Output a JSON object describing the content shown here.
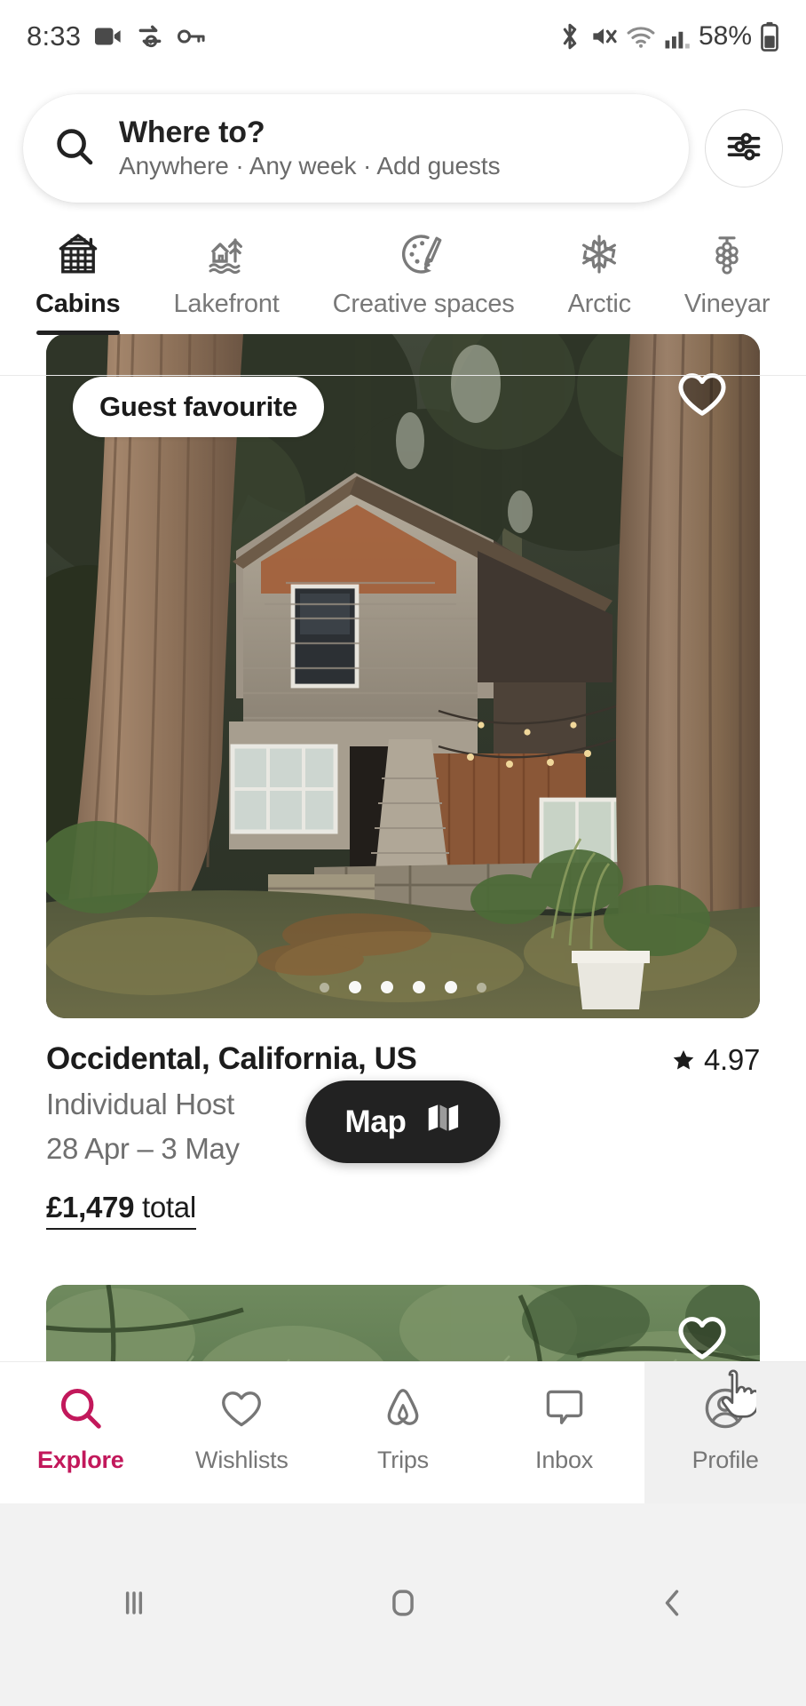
{
  "status_bar": {
    "time": "8:33",
    "left_icons": [
      "video-camera-icon",
      "sync-icon",
      "key-icon"
    ],
    "right_icons": [
      "bluetooth-icon",
      "mute-icon",
      "wifi-icon",
      "signal-icon"
    ],
    "battery_percent": "58%"
  },
  "search": {
    "title": "Where to?",
    "subtitle": "Anywhere · Any week · Add guests",
    "icon": "search-icon",
    "filter_icon": "filter-sliders-icon"
  },
  "categories": [
    {
      "label": "Cabins",
      "icon": "cabin-icon",
      "active": true
    },
    {
      "label": "Lakefront",
      "icon": "lakefront-icon",
      "active": false
    },
    {
      "label": "Creative spaces",
      "icon": "palette-icon",
      "active": false
    },
    {
      "label": "Arctic",
      "icon": "snowflake-icon",
      "active": false
    },
    {
      "label": "Vineyar",
      "icon": "grapes-icon",
      "active": false
    }
  ],
  "listing": {
    "badge": "Guest favourite",
    "location": "Occidental, California, US",
    "rating": "4.97",
    "rating_icon": "star-icon",
    "host": "Individual Host",
    "dates": "28 Apr – 3 May",
    "price_amount": "£1,479",
    "price_suffix": " total",
    "favourite_icon": "heart-icon",
    "carousel_dot_count": 6,
    "carousel_active_index": 1
  },
  "listing_2": {
    "favourite_icon": "heart-icon"
  },
  "map_button": {
    "label": "Map",
    "icon": "map-icon"
  },
  "bottom_nav": [
    {
      "label": "Explore",
      "icon": "search-icon",
      "active": true
    },
    {
      "label": "Wishlists",
      "icon": "heart-icon",
      "active": false
    },
    {
      "label": "Trips",
      "icon": "airbnb-bellhop-icon",
      "active": false
    },
    {
      "label": "Inbox",
      "icon": "chat-bubble-icon",
      "active": false
    },
    {
      "label": "Profile",
      "icon": "profile-avatar-icon",
      "active": false
    }
  ],
  "android_nav": [
    {
      "name": "recents-button",
      "icon": "recents-icon"
    },
    {
      "name": "home-button",
      "icon": "home-icon"
    },
    {
      "name": "back-button",
      "icon": "back-chevron-icon"
    }
  ],
  "colors": {
    "accent": "#C2185B",
    "text_primary": "#1c1c1c",
    "text_secondary": "#6f6f6f",
    "map_button_bg": "#222222"
  }
}
